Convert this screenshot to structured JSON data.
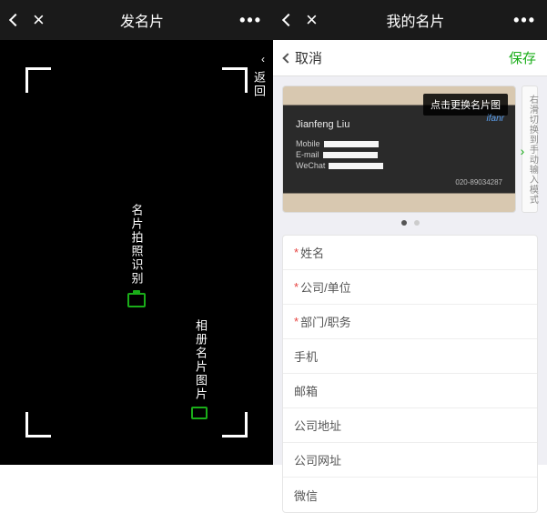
{
  "left": {
    "title": "发名片",
    "back_label": "返回",
    "center_label": "名片拍照识别",
    "gallery_label": "相册名片图片",
    "more": "•••"
  },
  "right": {
    "title": "我的名片",
    "cancel": "取消",
    "save": "保存",
    "overlay_tag": "点击更换名片图",
    "side_hint": "右滑切换到手动输入模式",
    "brand": "ifanr",
    "card_name": "Jianfeng Liu",
    "card_mobile_label": "Mobile",
    "card_email_label": "E-mail",
    "card_wechat_label": "WeChat",
    "card_phone": "020-89034287",
    "pager": {
      "count": 2,
      "active": 0
    },
    "fields": [
      {
        "label": "姓名",
        "required": true
      },
      {
        "label": "公司/单位",
        "required": true
      },
      {
        "label": "部门/职务",
        "required": true
      },
      {
        "label": "手机",
        "required": false
      },
      {
        "label": "邮箱",
        "required": false
      },
      {
        "label": "公司地址",
        "required": false
      },
      {
        "label": "公司网址",
        "required": false
      },
      {
        "label": "微信",
        "required": false
      }
    ]
  }
}
